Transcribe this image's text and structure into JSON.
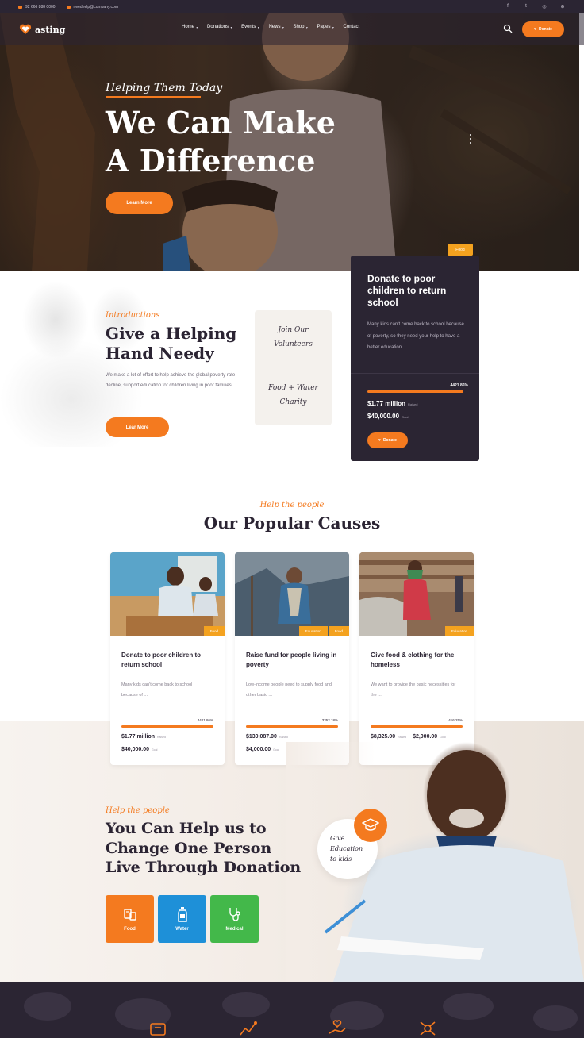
{
  "topbar": {
    "phone": "92 666 888 0000",
    "email": "needhelp@company.com",
    "socials": [
      "facebook-icon",
      "twitter-icon",
      "instagram-icon",
      "dribbble-icon"
    ]
  },
  "nav": {
    "logo": "asting",
    "menu": [
      {
        "label": "Home",
        "caret": true
      },
      {
        "label": "Donations",
        "caret": true
      },
      {
        "label": "Events",
        "caret": true
      },
      {
        "label": "News",
        "caret": true
      },
      {
        "label": "Shop",
        "caret": true
      },
      {
        "label": "Pages",
        "caret": true
      },
      {
        "label": "Contact",
        "caret": false
      }
    ],
    "donate_label": "Donate"
  },
  "hero": {
    "subtitle": "Helping Them Today",
    "title_line1": "We Can Make",
    "title_line2": "A Difference",
    "button": "Learn More"
  },
  "intro": {
    "script": "Introductions",
    "title": "Give a Helping Hand Needy",
    "text": "We make a lot of effort to help achieve the global poverty rate decline, support education for children living in poor families.",
    "button": "Lear More",
    "note_line1": "Join Our",
    "note_line2": "Volunteers",
    "note_line3": "Food + Water",
    "note_line4": "Charity"
  },
  "featured": {
    "tag": "Food",
    "title": "Donate to poor children to return school",
    "text": "Many kids can't come back to school because of poverty, so they need your help to have a better education.",
    "percent_label": "4421.86%",
    "progress": 1.0,
    "raised": "$1.77 million",
    "raised_label": "Raised",
    "goal": "$40,000.00",
    "goal_label": "Goal",
    "button": "Donate"
  },
  "causes": {
    "script": "Help the people",
    "title": "Our Popular Causes",
    "items": [
      {
        "tags": [
          "Food"
        ],
        "title": "Donate to poor children to return school",
        "text": "Many kids can't come back to school because of ...",
        "percent_label": "4421.86%",
        "progress": 1.0,
        "raised": "$1.77 million",
        "raised_label": "Raised",
        "goal": "$40,000.00",
        "goal_label": "Goal"
      },
      {
        "tags": [
          "Education",
          "Food"
        ],
        "title": "Raise fund for people living in poverty",
        "text": "Low-income people need to supply food and other basic ...",
        "percent_label": "3352.18%",
        "progress": 1.0,
        "raised": "$130,087.00",
        "raised_label": "Raised",
        "goal": "$4,000.00",
        "goal_label": "Goal"
      },
      {
        "tags": [
          "Education"
        ],
        "title": "Give food & clothing for the homeless",
        "text": "We want to provide the basic necessities for the ...",
        "percent_label": "416.25%",
        "progress": 1.0,
        "raised": "$8,325.00",
        "raised_label": "Raised",
        "goal": "$2,000.00",
        "goal_label": "Goal"
      }
    ]
  },
  "help": {
    "script": "Help the people",
    "title": "You Can Help us to Change One Person Live Through Donation",
    "cards": [
      {
        "label": "Food",
        "color": "#f47a1f",
        "icon": "food-icon"
      },
      {
        "label": "Water",
        "color": "#1e90d8",
        "icon": "water-icon"
      },
      {
        "label": "Medical",
        "color": "#43b84a",
        "icon": "medical-icon"
      }
    ],
    "bubble_text": "Give Education to kids"
  },
  "colors": {
    "accent": "#f47a1f",
    "dark": "#2b2533",
    "tag": "#f4a21f"
  }
}
